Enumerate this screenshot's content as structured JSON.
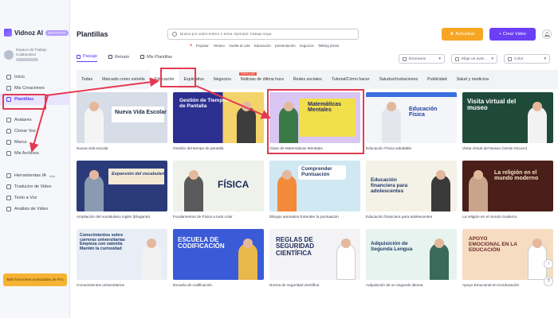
{
  "app": {
    "name": "Vidnoz AI",
    "badge": "GRATUITO"
  },
  "workspace": {
    "line1": "Espacio de Trabajo",
    "line2": "Colaborativo",
    "line3": "Miembro libre"
  },
  "sidebar": {
    "items": [
      {
        "label": "Inicio",
        "icon": "home-icon"
      },
      {
        "label": "Mis Creaciones",
        "icon": "folder-icon"
      },
      {
        "label": "Plantillas",
        "icon": "template-icon",
        "active": true
      },
      {
        "label": "Avatares",
        "icon": "avatar-icon"
      },
      {
        "label": "Clonar Voz",
        "icon": "voice-icon"
      },
      {
        "label": "Marca",
        "icon": "brand-icon"
      },
      {
        "label": "Mis Archivos",
        "icon": "files-icon"
      }
    ],
    "tools": [
      {
        "label": "Herramientas IA",
        "badge": "Más"
      },
      {
        "label": "Traductor de Video"
      },
      {
        "label": "Texto a Voz"
      },
      {
        "label": "Análisis de Video"
      }
    ],
    "upgrade_label": "Más funciones avanzadas de Pro"
  },
  "header": {
    "title": "Plantillas",
    "search_placeholder": "Busca por video entero o tema. Ejemplo: trabajo sega",
    "popular_label": "Popular:",
    "popular_tags": [
      "Verano",
      "Vuelta al cole",
      "Educación",
      "presentación",
      "negocios",
      "Talking photo"
    ],
    "upgrade_btn": "Actualizar",
    "create_btn": "+ Crear Video"
  },
  "source_tabs": [
    {
      "label": "Paisaje",
      "active": true
    },
    {
      "label": "Retrato"
    },
    {
      "label": "Mis Plantillas"
    }
  ],
  "filters": [
    "Escenario",
    "Elige un avat...",
    "Color"
  ],
  "categories": [
    {
      "label": "Todas"
    },
    {
      "label": "Marcado como estrella"
    },
    {
      "label": "Educación",
      "active": true
    },
    {
      "label": "Explicativo"
    },
    {
      "label": "Negocios"
    },
    {
      "label": "Noticias de última hora",
      "badge": "POPULAR"
    },
    {
      "label": "Redes sociales"
    },
    {
      "label": "Tutorial/Cómo hacer"
    },
    {
      "label": "Saludos/Invitaciones"
    },
    {
      "label": "Publicidad"
    },
    {
      "label": "Salud y medicina"
    }
  ],
  "templates": [
    {
      "caption": "Nueva vida escolar",
      "title": "Nueva Vida Escolar",
      "bg": "#d7dde6"
    },
    {
      "caption": "Gestión del tiempo de pantalla",
      "title": "Gestión de Tiempos de Pantalla",
      "bg": "#2c2f8f"
    },
    {
      "caption": "Clase de Matemáticas Mentales",
      "title": "Matemáticas Mentales",
      "bg": "#d9c6f2"
    },
    {
      "caption": "Educación Física saludable",
      "title": "Educación Física",
      "bg": "#f4f5f9"
    },
    {
      "caption": "Visita virtual del Museo (Verde Oscuro)",
      "title": "Visita virtual del museo",
      "bg": "#1f4a3a"
    },
    {
      "caption": "Ampliación del vocabulario inglés (Elegante)",
      "title": "Expansión del vocabulario",
      "bg": "#2b3b7a"
    },
    {
      "caption": "Fundamentos de Física a todo color",
      "title": "FÍSICA",
      "bg": "#eef2ea"
    },
    {
      "caption": "Dibujos animados Entender la puntuación",
      "title": "Comprender Puntuación",
      "bg": "#cfe8f2"
    },
    {
      "caption": "Educación financiera para adolescentes",
      "title": "Educación financiera para adolescentes",
      "bg": "#f4f1e6"
    },
    {
      "caption": "La religión en el mundo moderno",
      "title": "La religión en el mundo moderno",
      "bg": "#4a1f1a"
    },
    {
      "caption": "Conocimientos universitarios",
      "title": "Conocimientos sobre carreras universitarias Empieza con valentía Mantén la curiosidad",
      "bg": "#e8eef6"
    },
    {
      "caption": "Escuela de codificación",
      "title": "ESCUELA DE CODIFICACIÓN",
      "bg": "#3a5ad8"
    },
    {
      "caption": "Norma de seguridad científica",
      "title": "REGLAS DE SEGURIDAD CIENTÍFICA",
      "bg": "#f3f3f6"
    },
    {
      "caption": "Adquisición de un segundo idioma",
      "title": "Adquisición de Segunda Lengua",
      "bg": "#e6f3ee"
    },
    {
      "caption": "Apoyo Emocional en la Educación",
      "title": "APOYO EMOCIONAL EN LA EDUCACIÓN",
      "bg": "#f6dcc0"
    }
  ]
}
